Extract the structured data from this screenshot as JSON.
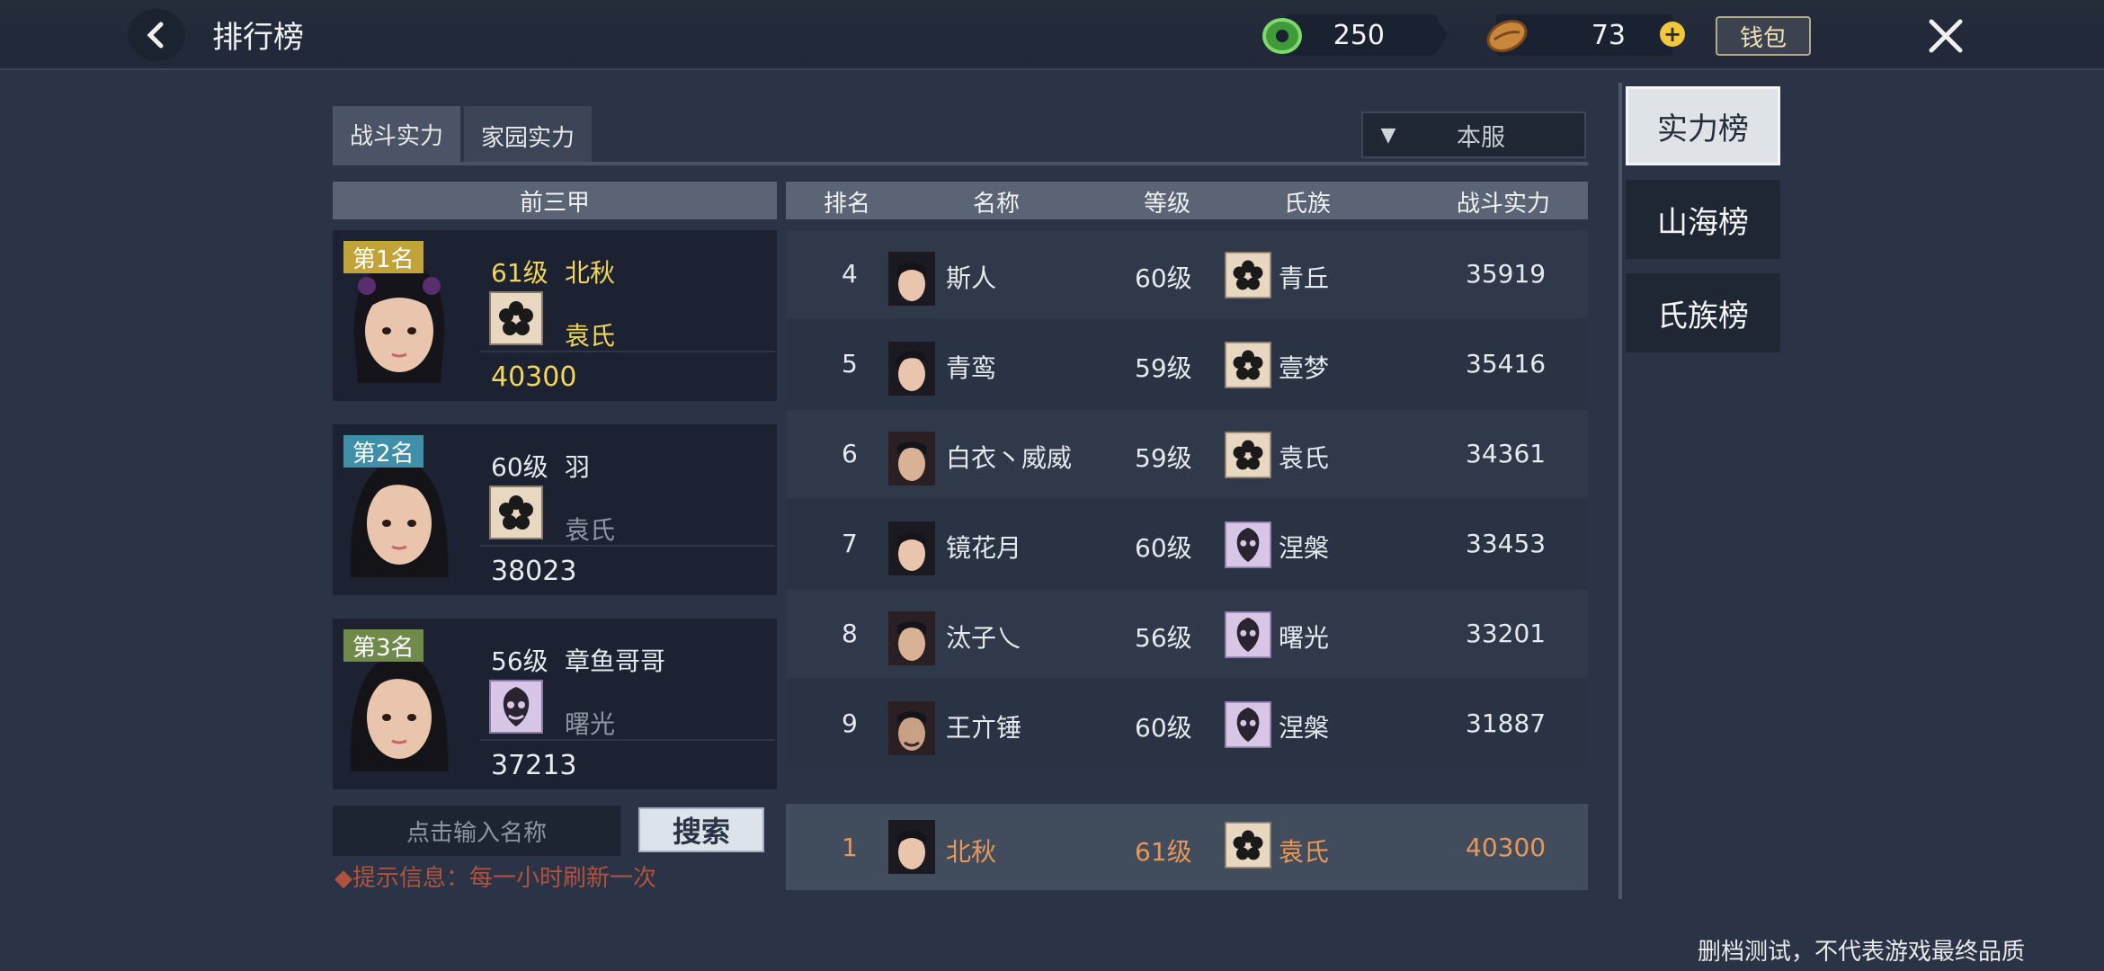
{
  "header": {
    "title": "排行榜",
    "currency1": "250",
    "currency2": "73",
    "wallet_label": "钱包"
  },
  "tabs": [
    {
      "label": "战斗实力",
      "active": true
    },
    {
      "label": "家园实力",
      "active": false
    }
  ],
  "server_select": {
    "value": "本服"
  },
  "top3": {
    "header": "前三甲",
    "cards": [
      {
        "rank": "第1名",
        "level": "61级",
        "name": "北秋",
        "clan": "袁氏",
        "power": "40300",
        "clan_icon": "sakura-icon"
      },
      {
        "rank": "第2名",
        "level": "60级",
        "name": "羽",
        "clan": "袁氏",
        "power": "38023",
        "clan_icon": "sakura-icon"
      },
      {
        "rank": "第3名",
        "level": "56级",
        "name": "章鱼哥哥",
        "clan": "曙光",
        "power": "37213",
        "clan_icon": "mask-icon"
      }
    ]
  },
  "table": {
    "headers": [
      "排名",
      "名称",
      "等级",
      "氏族",
      "战斗实力"
    ],
    "rows": [
      {
        "rank": "4",
        "name": "斯人",
        "level": "60级",
        "clan": "青丘",
        "power": "35919",
        "clan_icon": "sakura-icon"
      },
      {
        "rank": "5",
        "name": "青鸾",
        "level": "59级",
        "clan": "壹梦",
        "power": "35416",
        "clan_icon": "sakura-icon"
      },
      {
        "rank": "6",
        "name": "白衣丶威威",
        "level": "59级",
        "clan": "袁氏",
        "power": "34361",
        "clan_icon": "sakura-icon"
      },
      {
        "rank": "7",
        "name": "镜花月",
        "level": "60级",
        "clan": "涅槃",
        "power": "33453",
        "clan_icon": "mask-icon"
      },
      {
        "rank": "8",
        "name": "汰子乀",
        "level": "56级",
        "clan": "曙光",
        "power": "33201",
        "clan_icon": "mask-icon"
      },
      {
        "rank": "9",
        "name": "王亣锤",
        "level": "60级",
        "clan": "涅槃",
        "power": "31887",
        "clan_icon": "mask-icon"
      }
    ],
    "my_row": {
      "rank": "1",
      "name": "北秋",
      "level": "61级",
      "clan": "袁氏",
      "power": "40300",
      "clan_icon": "sakura-icon"
    }
  },
  "search": {
    "placeholder": "点击输入名称",
    "button": "搜索",
    "hint": "提示信息：每一小时刷新一次"
  },
  "side_nav": [
    {
      "label": "实力榜",
      "active": true
    },
    {
      "label": "山海榜",
      "active": false
    },
    {
      "label": "氏族榜",
      "active": false
    }
  ],
  "footer_note": "删档测试，不代表游戏最终品质",
  "colors": {
    "gold": "#f2d65a",
    "highlight": "#e6985a",
    "hint": "#b0533e",
    "tab_underline": "#e7c43e"
  }
}
